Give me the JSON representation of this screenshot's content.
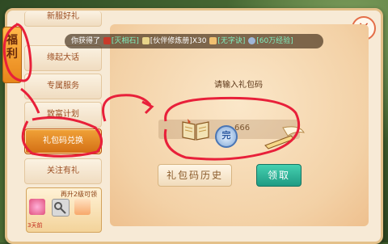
{
  "welfare_tab": {
    "chars": [
      "福",
      "利"
    ]
  },
  "sidebar": {
    "items": [
      {
        "label": "新服好礼"
      },
      {
        "label": "缘起大话"
      },
      {
        "label": "专属服务"
      },
      {
        "label": "致富计划"
      },
      {
        "label": "礼包码兑换"
      },
      {
        "label": "关注有礼"
      }
    ],
    "active_index": 4
  },
  "ticker": {
    "prefix": "你获得了",
    "items": [
      "[灭相石]",
      "[伙伴修炼册]X30",
      "[无字诀]",
      "[60万经验]"
    ]
  },
  "redeem": {
    "prompt": "请输入礼包码",
    "input_value": "666",
    "coin_glyph": "完",
    "history_button": "礼包码历史",
    "claim_button": "领取"
  },
  "promo": {
    "title": "再升2级可领",
    "timer": "3天前"
  },
  "close_icon_glyph": "×",
  "colors": {
    "accent": "#e7861a",
    "claim": "#1f9b83",
    "annotation": "#e8203a"
  }
}
